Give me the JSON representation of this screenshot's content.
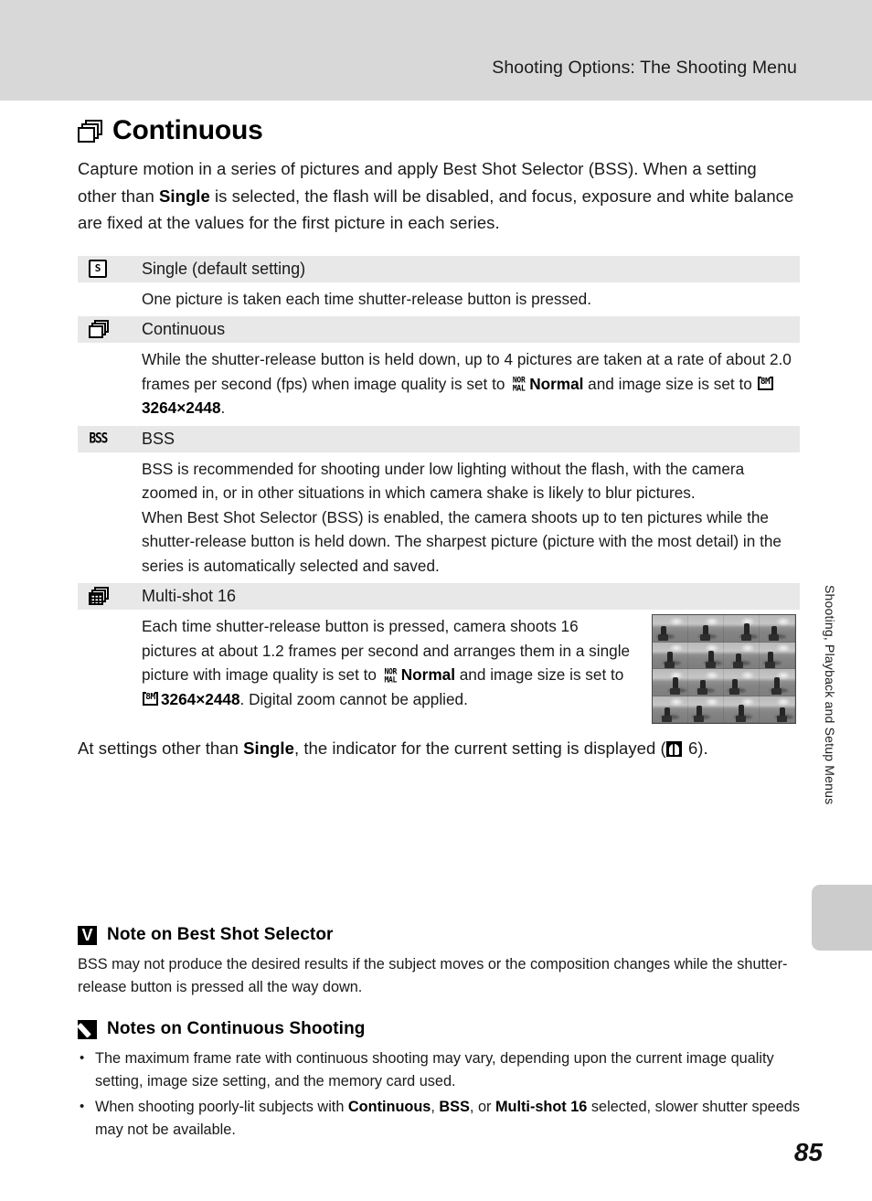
{
  "header": {
    "title": "Shooting Options: The Shooting Menu"
  },
  "side_tab": {
    "label": "Shooting, Playback and Setup Menus"
  },
  "page_number": "85",
  "heading": {
    "icon": "continuous-stack-icon",
    "text": "Continuous"
  },
  "intro": {
    "part1": "Capture motion in a series of pictures and apply Best Shot Selector (BSS). When a setting other than ",
    "bold1": "Single",
    "part2": " is selected, the flash will be disabled, and focus, exposure and white balance are fixed at the values for the first picture in each series."
  },
  "options": [
    {
      "icon": "single-shot-icon",
      "icon_glyph": "S",
      "label": "Single (default setting)",
      "body": "One picture is taken each time shutter-release button is pressed."
    },
    {
      "icon": "continuous-stack-icon",
      "label": "Continuous",
      "body_part1": "While the shutter-release button is held down, up to 4 pictures are taken at a rate of about 2.0 frames per second (fps) when image quality is set to ",
      "badge_normal_top": "NOR",
      "badge_normal_bottom": "MAL",
      "bold_normal": "Normal",
      "body_part2": " and image size is set to ",
      "badge_size": "8M",
      "bold_size": "3264×2448",
      "body_part3": "."
    },
    {
      "icon": "bss-icon",
      "icon_glyph": "BSS",
      "label": "BSS",
      "body_para1": "BSS is recommended for shooting under low lighting without the flash, with the camera zoomed in, or in other situations in which camera shake is likely to blur pictures.",
      "body_para2": "When Best Shot Selector (BSS) is enabled, the camera shoots up to ten pictures while the shutter-release button is held down. The sharpest picture (picture with the most detail) in the series is automatically selected and saved."
    },
    {
      "icon": "multi-shot-grid-icon",
      "label": "Multi-shot 16",
      "body_part1": "Each time shutter-release button is pressed, camera shoots 16 pictures at about 1.2 frames per second and arranges them in a single picture with image quality is set to ",
      "badge_normal_top": "NOR",
      "badge_normal_bottom": "MAL",
      "bold_normal": "Normal",
      "body_part2": " and image size is set to ",
      "badge_size": "8M",
      "bold_size": "3264×2448",
      "body_part3": ". Digital zoom cannot be applied.",
      "figure": "multi-shot-16-sample-image"
    }
  ],
  "closing": {
    "part1": "At settings other than ",
    "bold1": "Single",
    "part2": ", the indicator for the current setting is displayed (",
    "ref_icon": "reference-book-icon",
    "ref_page": " 6).",
    "part3": ""
  },
  "notes": [
    {
      "icon": "caution-icon",
      "title": "Note on Best Shot Selector",
      "body": "BSS may not produce the desired results if the subject moves or the composition changes while the shutter-release button is pressed all the way down.",
      "items": []
    },
    {
      "icon": "pencil-note-icon",
      "title": "Notes on Continuous Shooting",
      "body": "",
      "items": [
        {
          "part1": "The maximum frame rate with continuous shooting may vary, depending upon the current image quality setting, image size setting, and the memory card used.",
          "bolds": []
        },
        {
          "part1": "When shooting poorly-lit subjects with ",
          "bold1": "Continuous",
          "mid1": ", ",
          "bold2": "BSS",
          "mid2": ", or ",
          "bold3": "Multi-shot 16",
          "tail": " selected, slower shutter speeds may not be available."
        }
      ]
    }
  ],
  "colors": {
    "header_band": "#d8d8d8",
    "row_header": "#e8e8e8",
    "side_tab": "#cccccc",
    "text": "#1a1a1a"
  }
}
